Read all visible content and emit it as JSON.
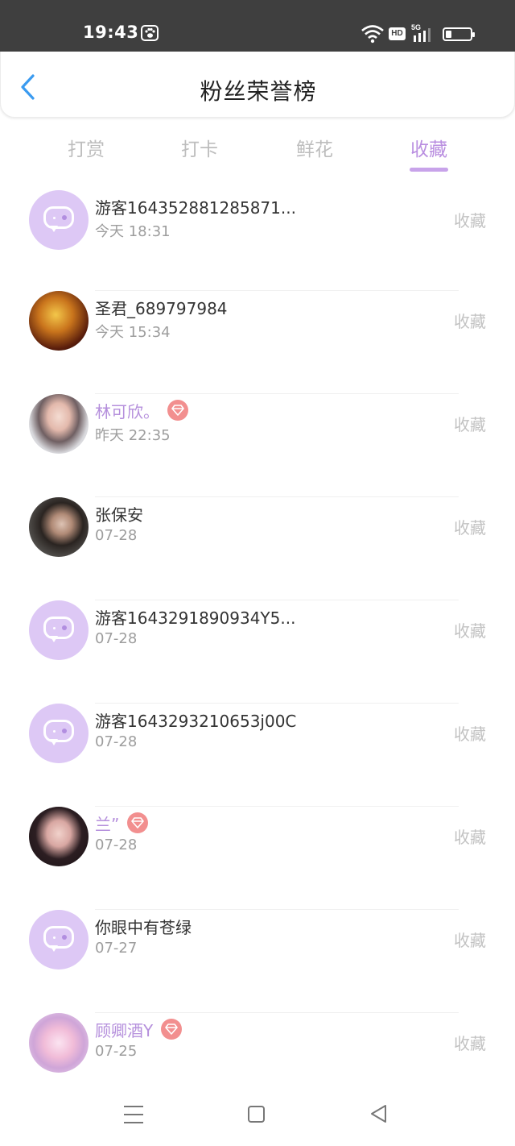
{
  "status_bar": {
    "time": "19:43",
    "icons": [
      "paw-icon",
      "wifi-icon",
      "hd-icon",
      "5g-signal-icon",
      "battery-icon"
    ],
    "hd_label": "HD",
    "network_label": "5G",
    "battery_level": 0.25
  },
  "header": {
    "title": "粉丝荣誉榜",
    "back_icon": "chevron-left-icon"
  },
  "tabs": {
    "items": [
      {
        "label": "打赏",
        "active": false
      },
      {
        "label": "打卡",
        "active": false
      },
      {
        "label": "鲜花",
        "active": false
      },
      {
        "label": "收藏",
        "active": true
      }
    ]
  },
  "list": {
    "items": [
      {
        "name": "游客164352881285871...",
        "time": "今天 18:31",
        "action": "收藏",
        "vip": false,
        "avatar": "default-chat-avatar"
      },
      {
        "name": "圣君_689797984",
        "time": "今天 15:34",
        "action": "收藏",
        "vip": false,
        "avatar": "photo-avatar"
      },
      {
        "name": "林可欣。",
        "time": "昨天 22:35",
        "action": "收藏",
        "vip": true,
        "avatar": "photo-avatar"
      },
      {
        "name": "张保安",
        "time": "07-28",
        "action": "收藏",
        "vip": false,
        "avatar": "photo-avatar"
      },
      {
        "name": "游客1643291890934Y5...",
        "time": "07-28",
        "action": "收藏",
        "vip": false,
        "avatar": "default-chat-avatar"
      },
      {
        "name": "游客1643293210653j00C",
        "time": "07-28",
        "action": "收藏",
        "vip": false,
        "avatar": "default-chat-avatar"
      },
      {
        "name": "兰”",
        "time": "07-28",
        "action": "收藏",
        "vip": true,
        "avatar": "photo-avatar"
      },
      {
        "name": "你眼中有苍绿",
        "time": "07-27",
        "action": "收藏",
        "vip": false,
        "avatar": "default-chat-avatar"
      },
      {
        "name": "顾卿酒Y",
        "time": "07-25",
        "action": "收藏",
        "vip": true,
        "avatar": "photo-avatar"
      }
    ]
  },
  "nav_bar": {
    "icons": [
      "menu-icon",
      "home-square-icon",
      "back-triangle-icon"
    ]
  },
  "colors": {
    "accent": "#b98ee0",
    "vip_badge": "#f28f8f",
    "default_avatar_bg": "#ddc8f5",
    "status_bar_bg": "#3f3f3f"
  }
}
